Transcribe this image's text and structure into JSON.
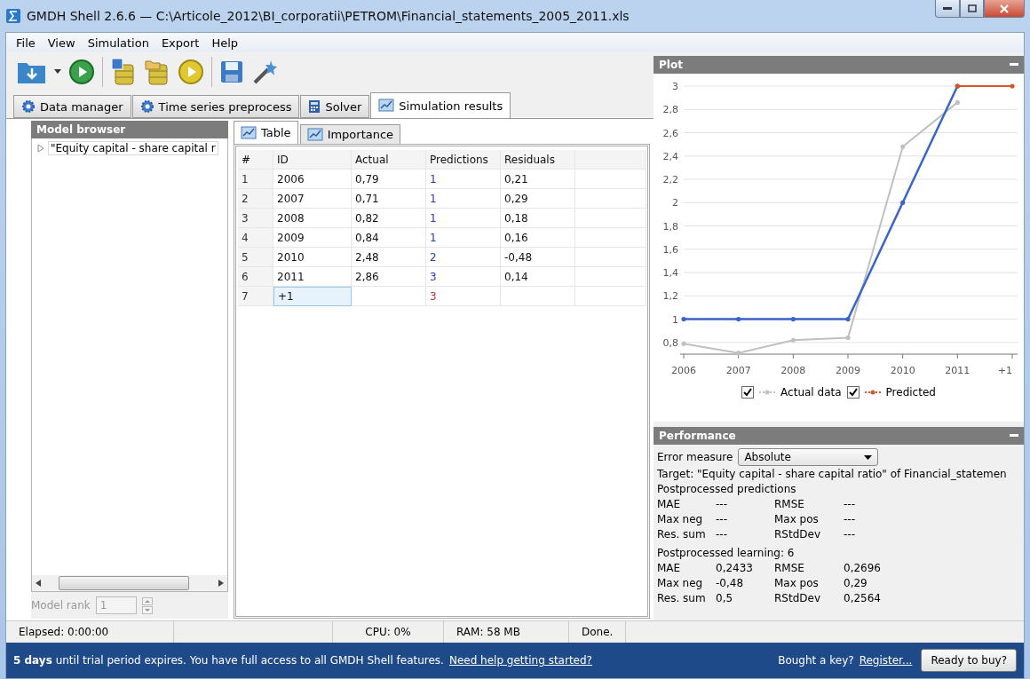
{
  "window": {
    "title": "GMDH Shell 2.6.6 — C:\\Articole_2012\\BI_corporatii\\PETROM\\Financial_statements_2005_2011.xls"
  },
  "menu": [
    "File",
    "View",
    "Simulation",
    "Export",
    "Help"
  ],
  "tabs": [
    {
      "label": "Data manager",
      "selected": false
    },
    {
      "label": "Time series preprocess",
      "selected": false
    },
    {
      "label": "Solver",
      "selected": false
    },
    {
      "label": "Simulation results",
      "selected": true
    }
  ],
  "model_browser": {
    "title": "Model browser",
    "items": [
      {
        "label": "\"Equity capital - share capital r",
        "expanded": false
      }
    ],
    "model_rank": {
      "label": "Model rank",
      "value": "1",
      "disabled": true
    }
  },
  "subtabs": [
    {
      "label": "Table",
      "selected": true
    },
    {
      "label": "Importance",
      "selected": false
    }
  ],
  "table": {
    "columns": [
      "#",
      "ID",
      "Actual",
      "Predictions",
      "Residuals"
    ],
    "rows": [
      {
        "kind": "fit",
        "selected": false,
        "cells": [
          "1",
          "2006",
          "0,79",
          "1",
          "0,21"
        ]
      },
      {
        "kind": "fit",
        "selected": false,
        "cells": [
          "2",
          "2007",
          "0,71",
          "1",
          "0,29"
        ]
      },
      {
        "kind": "fit",
        "selected": false,
        "cells": [
          "3",
          "2008",
          "0,82",
          "1",
          "0,18"
        ]
      },
      {
        "kind": "fit",
        "selected": false,
        "cells": [
          "4",
          "2009",
          "0,84",
          "1",
          "0,16"
        ]
      },
      {
        "kind": "fit",
        "selected": false,
        "cells": [
          "5",
          "2010",
          "2,48",
          "2",
          "-0,48"
        ]
      },
      {
        "kind": "fit",
        "selected": false,
        "cells": [
          "6",
          "2011",
          "2,86",
          "3",
          "0,14"
        ]
      },
      {
        "kind": "forecast",
        "selected": true,
        "cells": [
          "7",
          "+1",
          "",
          "3",
          ""
        ]
      }
    ]
  },
  "plot": {
    "title": "Plot",
    "chart_data": {
      "type": "line",
      "categories": [
        "2006",
        "2007",
        "2008",
        "2009",
        "2010",
        "2011",
        "+1"
      ],
      "ylim": [
        0.7,
        3
      ],
      "grid": true,
      "yticks": [
        {
          "value": 0.8,
          "label": "0,8"
        },
        {
          "value": 1,
          "label": "1"
        },
        {
          "value": 1.2,
          "label": "1,2"
        },
        {
          "value": 1.4,
          "label": "1,4"
        },
        {
          "value": 1.6,
          "label": "1,6"
        },
        {
          "value": 1.8,
          "label": "1,8"
        },
        {
          "value": 2,
          "label": "2"
        },
        {
          "value": 2.2,
          "label": "2,2"
        },
        {
          "value": 2.4,
          "label": "2,4"
        },
        {
          "value": 2.6,
          "label": "2,6"
        },
        {
          "value": 2.8,
          "label": "2,8"
        },
        {
          "value": 3,
          "label": "3"
        }
      ],
      "series": [
        {
          "name": "Actual data",
          "color": "#c0c0c0",
          "values": [
            0.79,
            0.71,
            0.82,
            0.84,
            2.48,
            2.86,
            null
          ]
        },
        {
          "color": "#3a64c8",
          "values": [
            1,
            1,
            1,
            1,
            2,
            3,
            null
          ]
        },
        {
          "name": "Predicted",
          "color": "#d0582a",
          "values": [
            null,
            null,
            null,
            null,
            null,
            3,
            3
          ]
        }
      ]
    },
    "legend": [
      {
        "checked": true
      },
      {
        "checked": true
      }
    ]
  },
  "performance": {
    "title": "Performance",
    "error_measure": {
      "label": "Error measure",
      "value": "Absolute"
    },
    "target": "Target: \"Equity capital - share capital ratio\" of Financial_statemen",
    "groups": [
      {
        "heading": "Postprocessed predictions",
        "rows": [
          [
            "MAE",
            "---",
            "RMSE",
            "---"
          ],
          [
            "Max neg",
            "---",
            "Max pos",
            "---"
          ],
          [
            "Res. sum",
            "---",
            "RStdDev",
            "---"
          ]
        ]
      },
      {
        "heading": "Postprocessed learning: 6",
        "rows": [
          [
            "MAE",
            "0,2433",
            "RMSE",
            "0,2696"
          ],
          [
            "Max neg",
            "-0,48",
            "Max pos",
            "0,29"
          ],
          [
            "Res. sum",
            "0,5",
            "RStdDev",
            "0,2564"
          ]
        ]
      }
    ]
  },
  "status_bar": [
    "Elapsed: 0:00:00",
    "CPU: 0%",
    "RAM: 58 MB",
    "Done."
  ],
  "trial_bar": {
    "message": "**5 days** until trial period expires. You have full access to all GMDH Shell features.",
    "help_link": "Need help getting started?",
    "key_text": "Bought a key?",
    "register_link": "Register...",
    "buy_button": "Ready to buy?"
  }
}
